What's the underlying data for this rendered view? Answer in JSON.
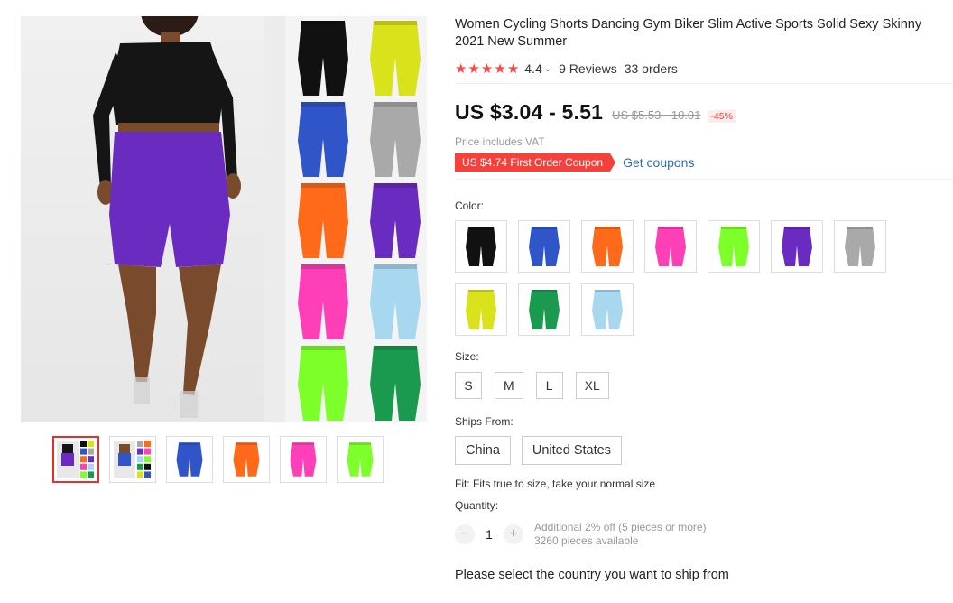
{
  "gallery": {
    "thumbnails": [
      {
        "kind": "model-grid",
        "selected": true
      },
      {
        "kind": "multi-grid",
        "selected": false
      },
      {
        "kind": "single",
        "color": "#2f55c8",
        "selected": false
      },
      {
        "kind": "single",
        "color": "#ff6a1a",
        "selected": false
      },
      {
        "kind": "single",
        "color": "#ff3fb7",
        "selected": false
      },
      {
        "kind": "single",
        "color": "#7dff2a",
        "selected": false
      }
    ],
    "grid_colors": [
      "#111111",
      "#d9e21a",
      "#2f55c8",
      "#a9a9a9",
      "#ff6a1a",
      "#6a2bc0",
      "#ff3fb7",
      "#a7d8ef",
      "#7dff2a",
      "#1a9a4e"
    ],
    "model_shorts_color": "#6a2bc0"
  },
  "product": {
    "title": "Women Cycling Shorts Dancing Gym Biker Slim Active Sports Solid Sexy Skinny 2021 New Summer",
    "rating": "4.4",
    "stars": 5,
    "reviews": "9 Reviews",
    "orders": "33 orders"
  },
  "pricing": {
    "price": "US $3.04 - 5.51",
    "original_price": "US $5.53 - 10.01",
    "discount": "-45%",
    "vat_note": "Price includes VAT",
    "coupon": "US $4.74 First Order Coupon",
    "get_coupons": "Get coupons"
  },
  "options": {
    "color_label": "Color:",
    "colors": [
      "#111111",
      "#2f55c8",
      "#ff6a1a",
      "#ff3fb7",
      "#7dff2a",
      "#6a2bc0",
      "#a9a9a9",
      "#d9e21a",
      "#1a9a4e",
      "#a7d8ef"
    ],
    "size_label": "Size:",
    "sizes": [
      "S",
      "M",
      "L",
      "XL"
    ],
    "ships_label": "Ships From:",
    "ships_from": [
      "China",
      "United States"
    ]
  },
  "fit_text": "Fit: Fits true to size, take your normal size",
  "quantity": {
    "label": "Quantity:",
    "value": "1",
    "minus": "−",
    "plus": "+",
    "note_line1": "Additional 2% off (5 pieces or more)",
    "note_line2": "3260 pieces available"
  },
  "ship_message": "Please select the country you want to ship from",
  "colors": {
    "accent_red": "#f5403c",
    "star_red": "#ff4747",
    "link_blue": "#2e6fb5"
  }
}
